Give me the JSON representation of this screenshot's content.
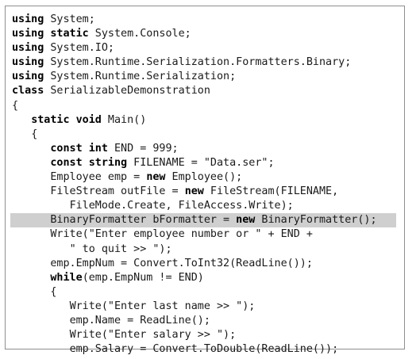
{
  "code": {
    "lines": [
      {
        "indent": "",
        "parts": [
          {
            "kw": "using"
          },
          {
            "t": " System;"
          }
        ]
      },
      {
        "indent": "",
        "parts": [
          {
            "kw": "using"
          },
          {
            "t": " "
          },
          {
            "kw": "static"
          },
          {
            "t": " System.Console;"
          }
        ]
      },
      {
        "indent": "",
        "parts": [
          {
            "kw": "using"
          },
          {
            "t": " System.IO;"
          }
        ]
      },
      {
        "indent": "",
        "parts": [
          {
            "kw": "using"
          },
          {
            "t": " System.Runtime.Serialization.Formatters.Binary;"
          }
        ]
      },
      {
        "indent": "",
        "parts": [
          {
            "kw": "using"
          },
          {
            "t": " System.Runtime.Serialization;"
          }
        ]
      },
      {
        "indent": "",
        "parts": [
          {
            "kw": "class"
          },
          {
            "t": " SerializableDemonstration"
          }
        ]
      },
      {
        "indent": "",
        "parts": [
          {
            "t": "{"
          }
        ]
      },
      {
        "indent": "   ",
        "parts": [
          {
            "kw": "static"
          },
          {
            "t": " "
          },
          {
            "kw": "void"
          },
          {
            "t": " Main()"
          }
        ]
      },
      {
        "indent": "   ",
        "parts": [
          {
            "t": "{"
          }
        ]
      },
      {
        "indent": "      ",
        "parts": [
          {
            "kw": "const"
          },
          {
            "t": " "
          },
          {
            "kw": "int"
          },
          {
            "t": " END = 999;"
          }
        ]
      },
      {
        "indent": "      ",
        "parts": [
          {
            "kw": "const"
          },
          {
            "t": " "
          },
          {
            "kw": "string"
          },
          {
            "t": " FILENAME = \"Data.ser\";"
          }
        ]
      },
      {
        "indent": "      ",
        "parts": [
          {
            "t": "Employee emp = "
          },
          {
            "kw": "new"
          },
          {
            "t": " Employee();"
          }
        ]
      },
      {
        "indent": "      ",
        "parts": [
          {
            "t": "FileStream outFile = "
          },
          {
            "kw": "new"
          },
          {
            "t": " FileStream(FILENAME,"
          }
        ]
      },
      {
        "indent": "         ",
        "parts": [
          {
            "t": "FileMode.Create, FileAccess.Write);"
          }
        ]
      },
      {
        "indent": "      ",
        "highlight": true,
        "parts": [
          {
            "t": "BinaryFormatter bFormatter = "
          },
          {
            "kw": "new"
          },
          {
            "t": " BinaryFormatter();"
          }
        ]
      },
      {
        "indent": "      ",
        "parts": [
          {
            "t": "Write(\"Enter employee number or \" + END +"
          }
        ]
      },
      {
        "indent": "         ",
        "parts": [
          {
            "t": "\" to quit >> \");"
          }
        ]
      },
      {
        "indent": "      ",
        "parts": [
          {
            "t": "emp.EmpNum = Convert.ToInt32(ReadLine());"
          }
        ]
      },
      {
        "indent": "      ",
        "parts": [
          {
            "kw": "while"
          },
          {
            "t": "(emp.EmpNum != END)"
          }
        ]
      },
      {
        "indent": "      ",
        "parts": [
          {
            "t": "{"
          }
        ]
      },
      {
        "indent": "         ",
        "parts": [
          {
            "t": "Write(\"Enter last name >> \");"
          }
        ]
      },
      {
        "indent": "         ",
        "parts": [
          {
            "t": "emp.Name = ReadLine();"
          }
        ]
      },
      {
        "indent": "         ",
        "parts": [
          {
            "t": "Write(\"Enter salary >> \");"
          }
        ]
      },
      {
        "indent": "         ",
        "parts": [
          {
            "t": "emp.Salary = Convert.ToDouble(ReadLine());"
          }
        ]
      }
    ]
  }
}
